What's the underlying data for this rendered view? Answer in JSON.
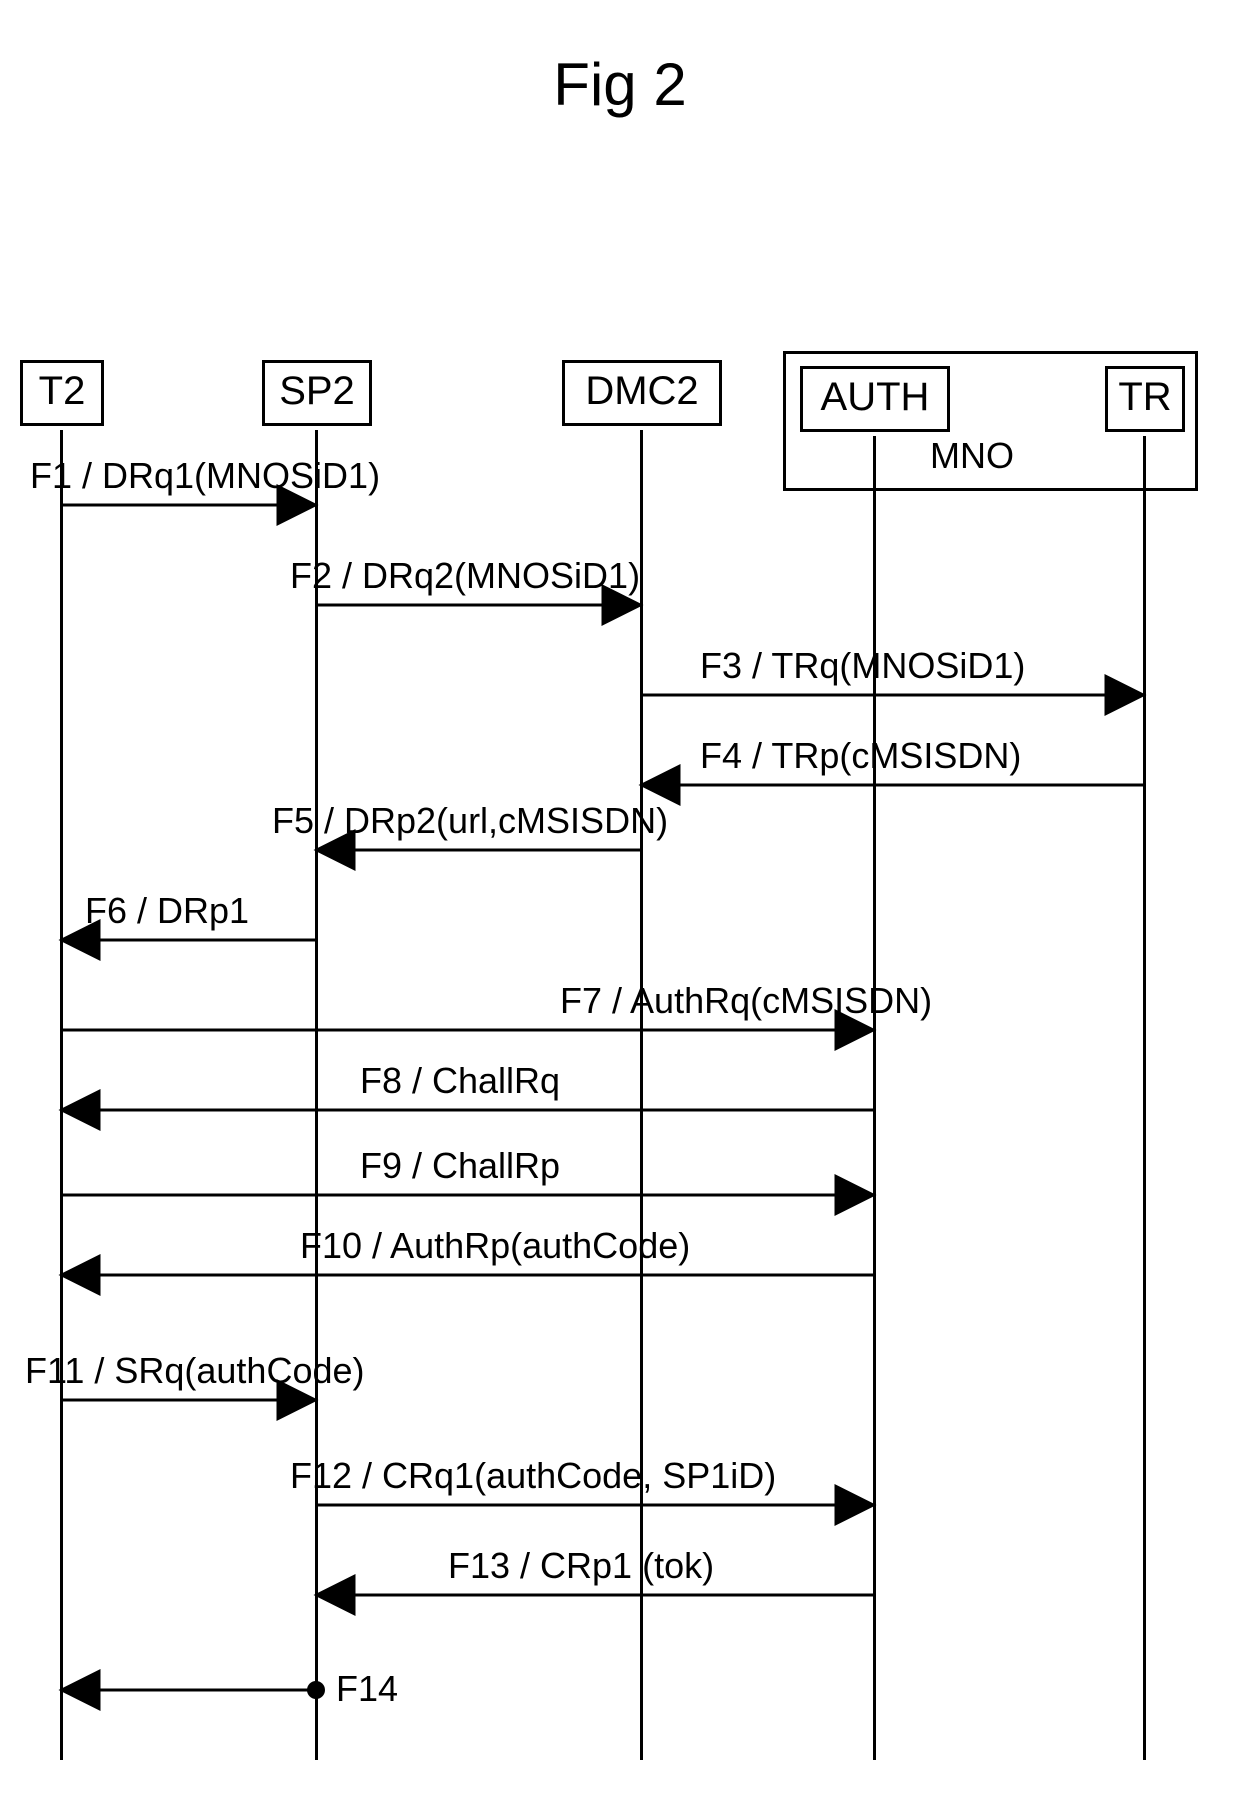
{
  "title": "Fig 2",
  "actors": {
    "t2": "T2",
    "sp2": "SP2",
    "dmc2": "DMC2",
    "auth": "AUTH",
    "tr": "TR"
  },
  "mno_label": "MNO",
  "messages": {
    "f1": "F1 / DRq1(MNOSiD1)",
    "f2": "F2 / DRq2(MNOSiD1)",
    "f3": "F3 / TRq(MNOSiD1)",
    "f4": "F4 / TRp(cMSISDN)",
    "f5": "F5 / DRp2(url,cMSISDN)",
    "f6": "F6 / DRp1",
    "f7": "F7 / AuthRq(cMSISDN)",
    "f8": "F8 / ChallRq",
    "f9": "F9 / ChallRp",
    "f10": "F10 / AuthRp(authCode)",
    "f11": "F11 / SRq(authCode)",
    "f12": "F12 / CRq1(authCode, SP1iD)",
    "f13": "F13 / CRp1 (tok)",
    "f14": "F14"
  }
}
